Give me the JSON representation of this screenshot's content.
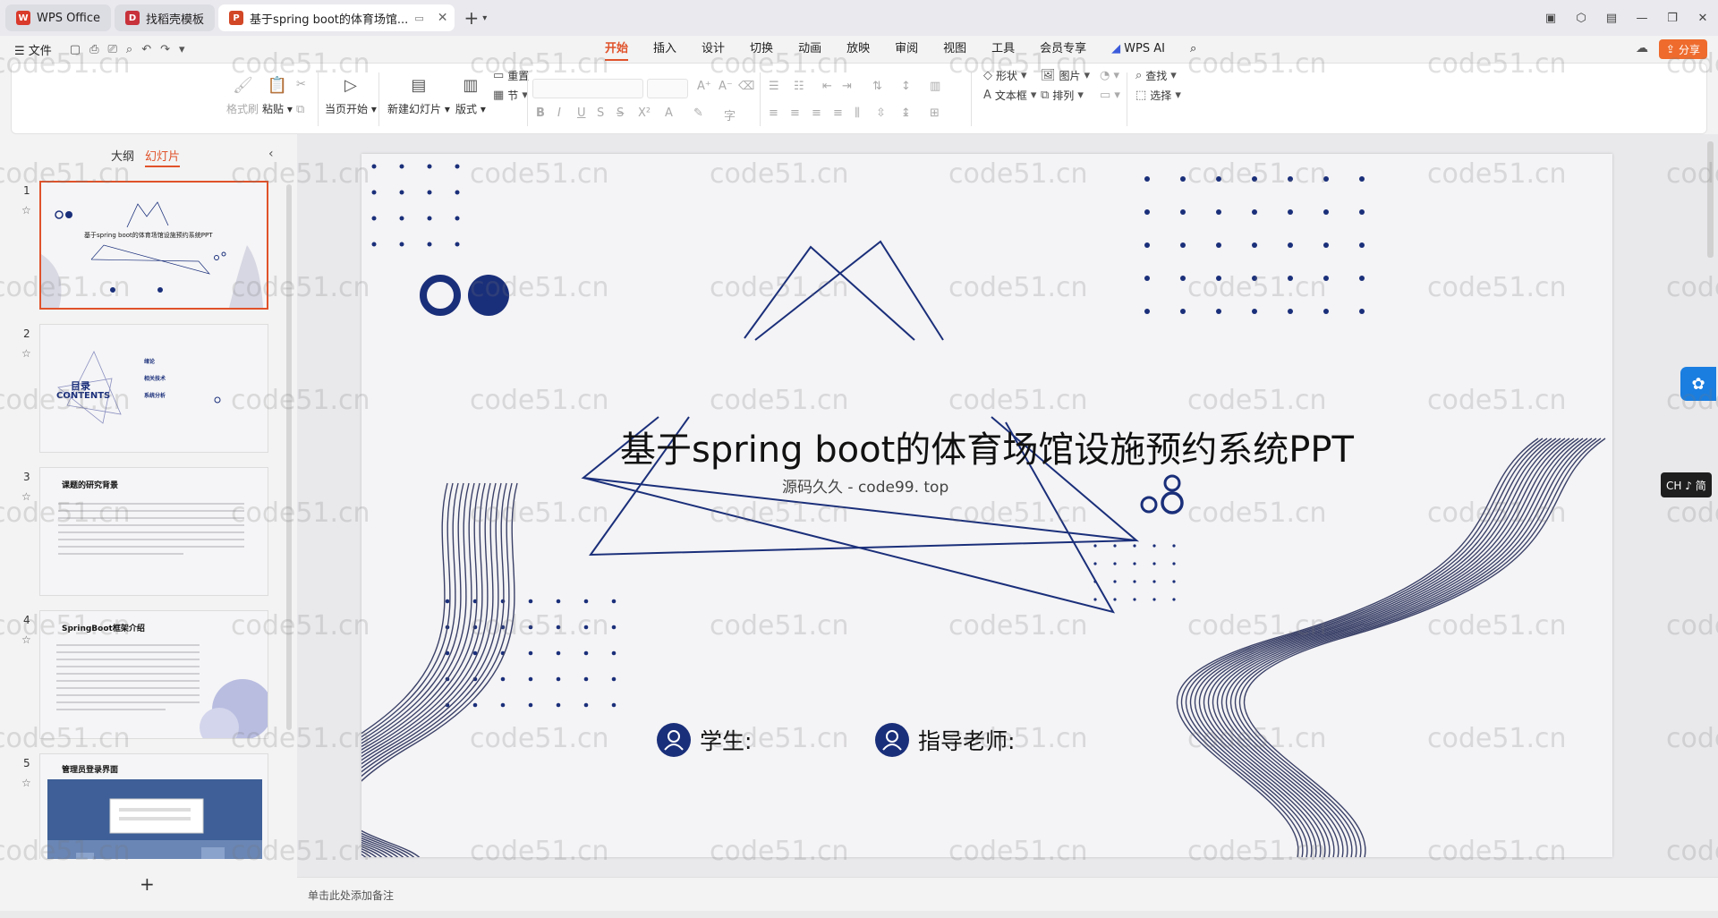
{
  "tabs": [
    {
      "label": "WPS Office",
      "badge": "W",
      "badge_color": "#d93a2b",
      "active": false
    },
    {
      "label": "找稻壳模板",
      "badge": "D",
      "badge_color": "#c8323a",
      "active": false
    },
    {
      "label": "基于spring boot的体育场馆...",
      "badge": "P",
      "badge_color": "#d24726",
      "active": true
    }
  ],
  "menu": {
    "file": "☰ 文件",
    "ribbon_tabs": [
      "开始",
      "插入",
      "设计",
      "切换",
      "动画",
      "放映",
      "审阅",
      "视图",
      "工具",
      "会员专享"
    ],
    "wps_ai": "WPS AI",
    "share": "分享"
  },
  "ribbon": {
    "format_painter": "格式刷",
    "paste": "粘贴",
    "play_from_current": "当页开始",
    "new_slide": "新建幻灯片",
    "layout": "版式",
    "reset": "重置",
    "section": "节",
    "shape": "形状",
    "picture": "图片",
    "textbox": "文本框",
    "arrange": "排列",
    "find": "查找",
    "select": "选择"
  },
  "left_panel": {
    "outline_tab": "大纲",
    "slides_tab": "幻灯片",
    "thumbnails": [
      {
        "num": "1",
        "title": "基于spring boot的体育场馆设施预约系统PPT"
      },
      {
        "num": "2",
        "title": "目录",
        "subtitle": "CONTENTS",
        "items": [
          "绪论",
          "相关技术",
          "系统分析"
        ]
      },
      {
        "num": "3",
        "title": "课题的研究背景"
      },
      {
        "num": "4",
        "title": "SpringBoot框架介绍"
      },
      {
        "num": "5",
        "title": "管理员登录界面"
      }
    ]
  },
  "slide": {
    "title": "基于spring boot的体育场馆设施预约系统PPT",
    "subtitle": "源码久久 - code99. top",
    "student_label": "学生:",
    "teacher_label": "指导老师:",
    "accent_color": "#1a2f7a"
  },
  "notes_placeholder": "单击此处添加备注",
  "ime": "CH ♪ 简",
  "watermark": "code51.cn"
}
